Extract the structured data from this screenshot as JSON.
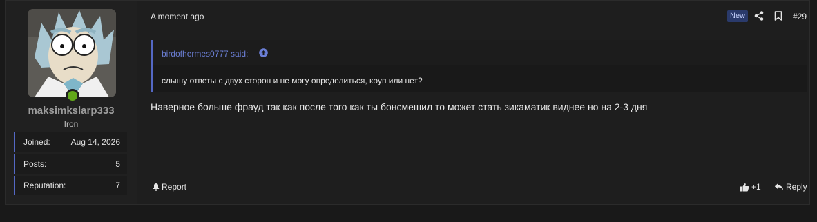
{
  "user": {
    "username": "maksimkslarp333",
    "rank": "Iron",
    "stats": [
      {
        "label": "Joined:",
        "value": "Aug 14, 2026"
      },
      {
        "label": "Posts:",
        "value": "5"
      },
      {
        "label": "Reputation:",
        "value": "7"
      }
    ]
  },
  "post": {
    "time": "A moment ago",
    "new_badge": "New",
    "number": "#29",
    "quote": {
      "author": "birdofhermes0777 said:",
      "text": "слышу ответы с двух сторон и не могу определиться, коуп или нет?"
    },
    "message": "Наверное больше фрауд так как после того как ты бонсмешил то может стать зикаматик виднее но на 2-3 дня",
    "actions": {
      "report": "Report",
      "likes": "+1",
      "reply": "Reply"
    }
  },
  "colors": {
    "accent": "#5468c4",
    "online": "#62a81a",
    "quote_author": "#6b7fd6",
    "background": "#191919"
  }
}
